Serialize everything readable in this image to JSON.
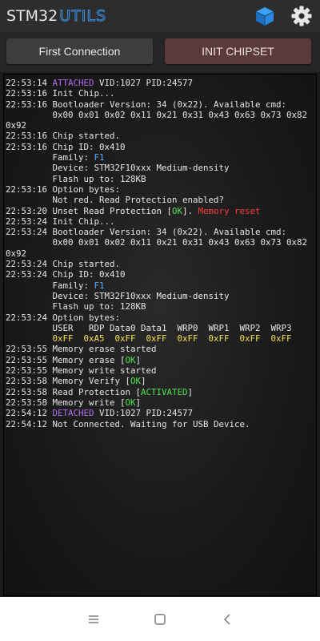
{
  "app": {
    "title_part1": "STM32",
    "title_part2": "UTILS"
  },
  "icons": {
    "cube": "cube-icon",
    "settings": "gear-icon",
    "clear_log": "trash-icon",
    "nav_recents": "menu-icon",
    "nav_home": "home-icon",
    "nav_back": "back-icon"
  },
  "colors": {
    "accent_blue": "#3a8fe0",
    "attached_purple": "#b36cf0",
    "ok_green": "#4fe34f",
    "error_red": "#ff3b3b",
    "option_yellow": "#f2e14a"
  },
  "buttons": {
    "first_connection": "First Connection",
    "init_chipset": "INIT CHIPSET"
  },
  "log": [
    [
      {
        "t": "22:53:14 "
      },
      {
        "t": "ATTACHED",
        "c": "purple"
      },
      {
        "t": " VID:1027 PID:24577"
      }
    ],
    [
      {
        "t": "22:53:16 Init Chip..."
      }
    ],
    [
      {
        "t": "22:53:16 Bootloader Version: 34 (0x22). Available cmd:"
      }
    ],
    [
      {
        "t": "         0x00 0x01 0x02 0x11 0x21 0x31 0x43 0x63 0x73 0x82"
      }
    ],
    [
      {
        "t": "0x92"
      }
    ],
    [
      {
        "t": "22:53:16 Chip started."
      }
    ],
    [
      {
        "t": "22:53:16 Chip ID: 0x410"
      }
    ],
    [
      {
        "t": "         Family: "
      },
      {
        "t": "F1",
        "c": "blue"
      }
    ],
    [
      {
        "t": "         Device: STM32F10xxx Medium-density"
      }
    ],
    [
      {
        "t": "         Flash up to: 128KB"
      }
    ],
    [
      {
        "t": "22:53:16 Option bytes:"
      }
    ],
    [
      {
        "t": "         Not red. Read Protection enabled?"
      }
    ],
    [
      {
        "t": "22:53:20 Unset Read Protection ["
      },
      {
        "t": "OK",
        "c": "green"
      },
      {
        "t": "]. "
      },
      {
        "t": "Memory reset",
        "c": "red"
      }
    ],
    [
      {
        "t": "22:53:24 Init Chip..."
      }
    ],
    [
      {
        "t": "22:53:24 Bootloader Version: 34 (0x22). Available cmd:"
      }
    ],
    [
      {
        "t": "         0x00 0x01 0x02 0x11 0x21 0x31 0x43 0x63 0x73 0x82"
      }
    ],
    [
      {
        "t": "0x92"
      }
    ],
    [
      {
        "t": "22:53:24 Chip started."
      }
    ],
    [
      {
        "t": "22:53:24 Chip ID: 0x410"
      }
    ],
    [
      {
        "t": "         Family: "
      },
      {
        "t": "F1",
        "c": "blue"
      }
    ],
    [
      {
        "t": "         Device: STM32F10xxx Medium-density"
      }
    ],
    [
      {
        "t": "         Flash up to: 128KB"
      }
    ],
    [
      {
        "t": "22:53:24 Option bytes:"
      }
    ],
    [
      {
        "t": "         USER   RDP Data0 Data1  WRP0  WRP1  WRP2  WRP3"
      }
    ],
    [
      {
        "t": "         0xFF  0xA5  0xFF  0xFF  0xFF  0xFF  0xFF  0xFF",
        "c": "yellow"
      }
    ],
    [
      {
        "t": "22:53:55 Memory erase started"
      }
    ],
    [
      {
        "t": "22:53:55 Memory erase ["
      },
      {
        "t": "OK",
        "c": "green"
      },
      {
        "t": "]"
      }
    ],
    [
      {
        "t": "22:53:55 Memory write started"
      }
    ],
    [
      {
        "t": "22:53:58 Memory Verify ["
      },
      {
        "t": "OK",
        "c": "green"
      },
      {
        "t": "]"
      }
    ],
    [
      {
        "t": "22:53:58 Read Protection ["
      },
      {
        "t": "ACTIVATED",
        "c": "green"
      },
      {
        "t": "]"
      }
    ],
    [
      {
        "t": "22:53:58 Memory write ["
      },
      {
        "t": "OK",
        "c": "green"
      },
      {
        "t": "]"
      }
    ],
    [
      {
        "t": "22:54:12 "
      },
      {
        "t": "DETACHED",
        "c": "purple"
      },
      {
        "t": " VID:1027 PID:24577"
      }
    ],
    [
      {
        "t": "22:54:12 Not Connected. Waiting for USB Device."
      }
    ]
  ]
}
